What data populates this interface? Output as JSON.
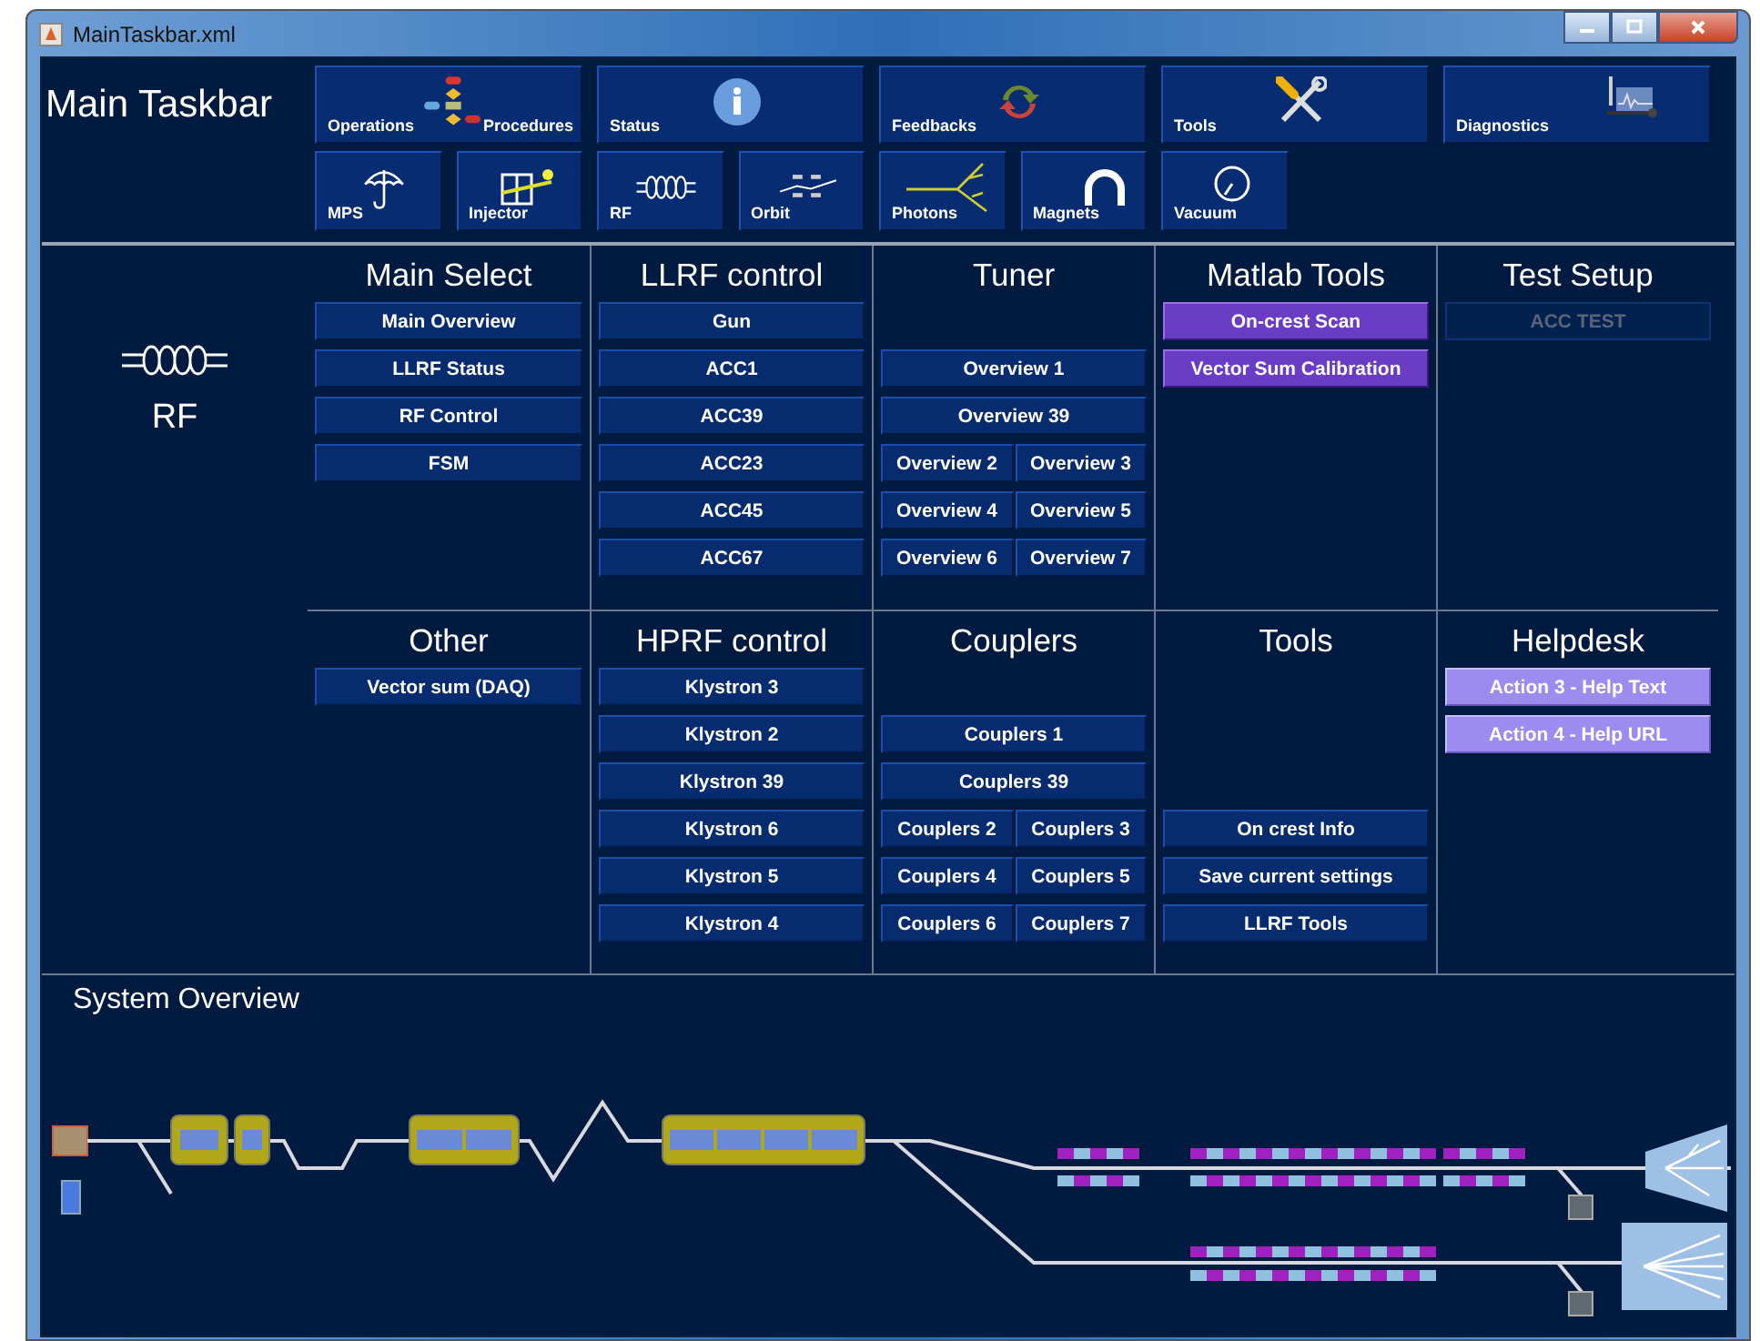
{
  "window": {
    "title": "MainTaskbar.xml"
  },
  "app_title": "Main Taskbar",
  "top_buttons": [
    {
      "kind": "wide",
      "labels": [
        "Operations",
        "Procedures"
      ]
    },
    {
      "kind": "wide",
      "labels": [
        "Status"
      ]
    },
    {
      "kind": "wide",
      "labels": [
        "Feedbacks"
      ]
    },
    {
      "kind": "wide",
      "labels": [
        "Tools"
      ]
    },
    {
      "kind": "wide",
      "labels": [
        "Diagnostics"
      ]
    },
    {
      "kind": "small",
      "labels": [
        "MPS"
      ]
    },
    {
      "kind": "small",
      "labels": [
        "Injector"
      ]
    },
    {
      "kind": "small",
      "labels": [
        "RF"
      ]
    },
    {
      "kind": "small",
      "labels": [
        "Orbit"
      ]
    },
    {
      "kind": "small",
      "labels": [
        "Photons"
      ]
    },
    {
      "kind": "small",
      "labels": [
        "Magnets"
      ]
    },
    {
      "kind": "small",
      "labels": [
        "Vacuum"
      ]
    }
  ],
  "panel": {
    "label": "RF"
  },
  "rows": [
    {
      "columns": [
        {
          "heading": "Main Select",
          "items": [
            {
              "kind": "button",
              "label": "Main Overview",
              "disabled": false
            },
            {
              "kind": "button",
              "label": "LLRF Status",
              "disabled": false
            },
            {
              "kind": "button",
              "label": "RF Control",
              "disabled": false
            },
            {
              "kind": "button",
              "label": "FSM",
              "disabled": false
            }
          ]
        },
        {
          "heading": "LLRF control",
          "items": [
            {
              "kind": "button",
              "label": "Gun",
              "disabled": false
            },
            {
              "kind": "button",
              "label": "ACC1",
              "disabled": false
            },
            {
              "kind": "button",
              "label": "ACC39",
              "disabled": false
            },
            {
              "kind": "button",
              "label": "ACC23",
              "disabled": false
            },
            {
              "kind": "button",
              "label": "ACC45",
              "disabled": false
            },
            {
              "kind": "button",
              "label": "ACC67",
              "disabled": false
            }
          ]
        },
        {
          "heading": "Tuner",
          "items": [
            {
              "kind": "gap"
            },
            {
              "kind": "button",
              "label": "Overview 1",
              "disabled": false
            },
            {
              "kind": "button",
              "label": "Overview 39",
              "disabled": false
            },
            {
              "kind": "pair",
              "buttons": [
                {
                  "label": "Overview 2",
                  "disabled": false
                },
                {
                  "label": "Overview 3",
                  "disabled": false
                }
              ]
            },
            {
              "kind": "pair",
              "buttons": [
                {
                  "label": "Overview 4",
                  "disabled": false
                },
                {
                  "label": "Overview 5",
                  "disabled": false
                }
              ]
            },
            {
              "kind": "pair",
              "buttons": [
                {
                  "label": "Overview 6",
                  "disabled": false
                },
                {
                  "label": "Overview 7",
                  "disabled": false
                }
              ]
            }
          ]
        },
        {
          "heading": "Matlab Tools",
          "items": [
            {
              "kind": "accent_button",
              "label": "On-crest Scan",
              "disabled": false
            },
            {
              "kind": "accent_button",
              "label": "Vector Sum Calibration",
              "disabled": false
            }
          ]
        },
        {
          "heading": "Test Setup",
          "items": [
            {
              "kind": "button",
              "label": "ACC TEST",
              "disabled": true
            }
          ]
        }
      ]
    },
    {
      "columns": [
        {
          "heading": "Other",
          "items": [
            {
              "kind": "button",
              "label": "Vector sum (DAQ)",
              "disabled": false
            }
          ]
        },
        {
          "heading": "HPRF control",
          "items": [
            {
              "kind": "button",
              "label": "Klystron 3",
              "disabled": false
            },
            {
              "kind": "button",
              "label": "Klystron 2",
              "disabled": false
            },
            {
              "kind": "button",
              "label": "Klystron 39",
              "disabled": false
            },
            {
              "kind": "button",
              "label": "Klystron 6",
              "disabled": false
            },
            {
              "kind": "button",
              "label": "Klystron 5",
              "disabled": false
            },
            {
              "kind": "button",
              "label": "Klystron 4",
              "disabled": false
            }
          ]
        },
        {
          "heading": "Couplers",
          "items": [
            {
              "kind": "gap"
            },
            {
              "kind": "button",
              "label": "Couplers 1",
              "disabled": false
            },
            {
              "kind": "button",
              "label": "Couplers 39",
              "disabled": false
            },
            {
              "kind": "pair",
              "buttons": [
                {
                  "label": "Couplers 2",
                  "disabled": false
                },
                {
                  "label": "Couplers 3",
                  "disabled": false
                }
              ]
            },
            {
              "kind": "pair",
              "buttons": [
                {
                  "label": "Couplers 4",
                  "disabled": false
                },
                {
                  "label": "Couplers 5",
                  "disabled": false
                }
              ]
            },
            {
              "kind": "pair",
              "buttons": [
                {
                  "label": "Couplers 6",
                  "disabled": false
                },
                {
                  "label": "Couplers 7",
                  "disabled": false
                }
              ]
            }
          ]
        },
        {
          "heading": "Tools",
          "items": [
            {
              "kind": "gap"
            },
            {
              "kind": "gap"
            },
            {
              "kind": "gap"
            },
            {
              "kind": "button",
              "label": "On crest Info",
              "disabled": false
            },
            {
              "kind": "button",
              "label": "Save current settings",
              "disabled": false
            },
            {
              "kind": "button",
              "label": "LLRF Tools",
              "disabled": false
            }
          ]
        },
        {
          "heading": "Helpdesk",
          "items": [
            {
              "kind": "light_button",
              "label": "Action 3 - Help Text",
              "disabled": false
            },
            {
              "kind": "light_button",
              "label": "Action 4 - Help URL",
              "disabled": false
            }
          ]
        }
      ]
    }
  ],
  "overview": {
    "title": "System Overview"
  }
}
